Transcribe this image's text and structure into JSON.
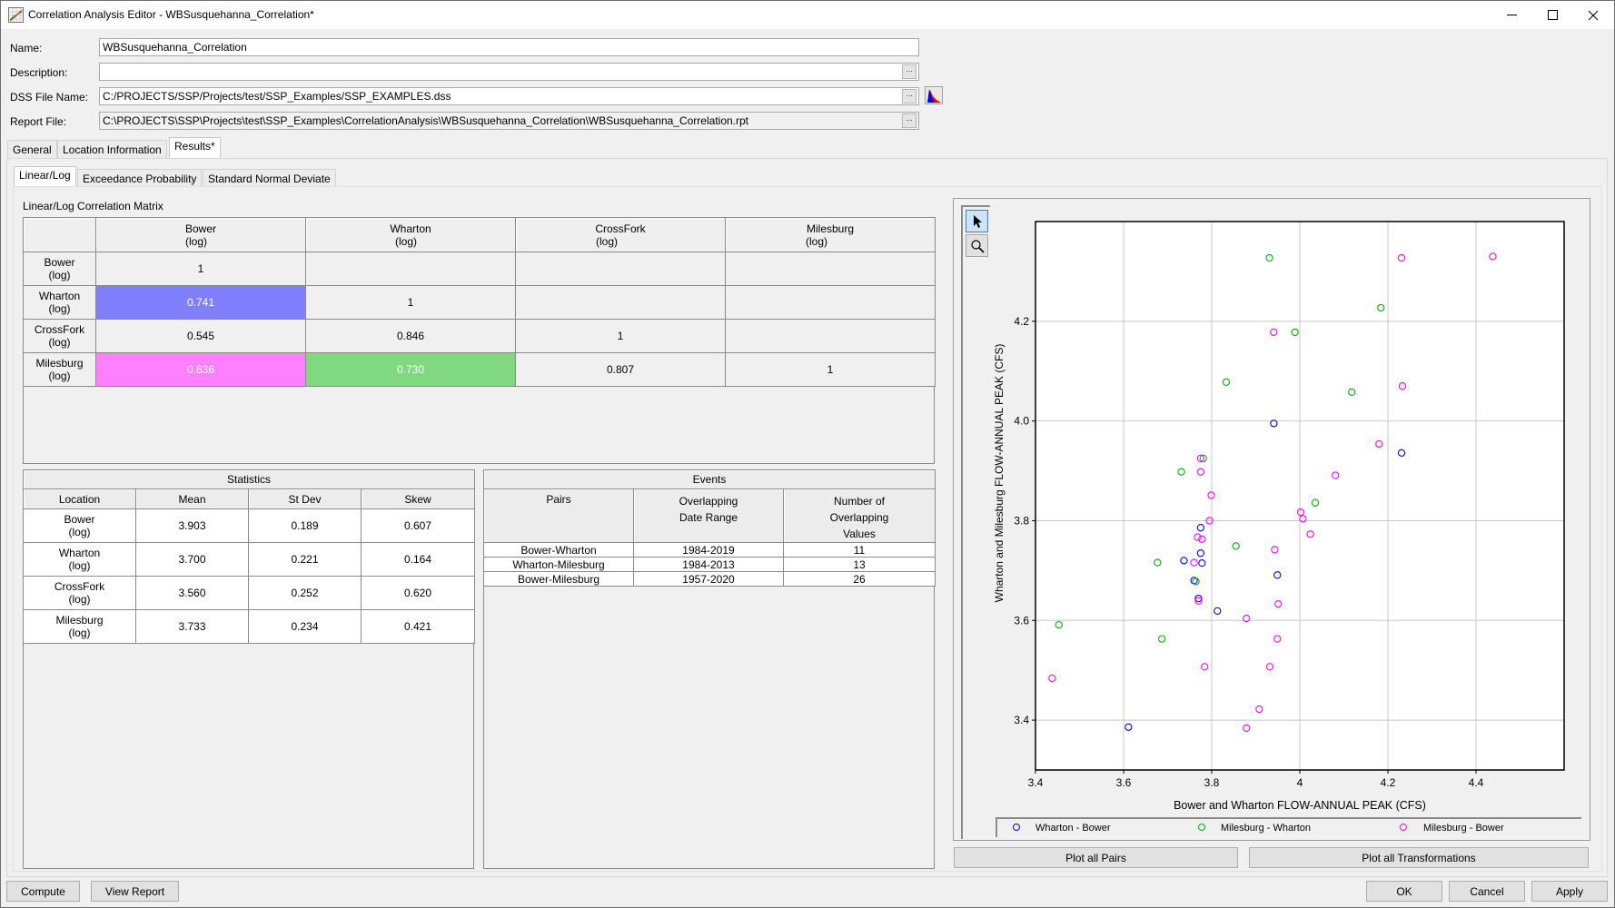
{
  "window": {
    "title": "Correlation Analysis Editor - WBSusquehanna_Correlation*",
    "minimize": "—",
    "maximize": "☐",
    "close": "✕"
  },
  "form": {
    "name_label": "Name:",
    "name_value": "WBSusquehanna_Correlation",
    "description_label": "Description:",
    "description_value": "",
    "dss_label": "DSS File Name:",
    "dss_value": "C:/PROJECTS/SSP/Projects/test/SSP_Examples/SSP_EXAMPLES.dss",
    "report_label": "Report File:",
    "report_value": "C:\\PROJECTS\\SSP\\Projects\\test\\SSP_Examples\\CorrelationAnalysis\\WBSusquehanna_Correlation\\WBSusquehanna_Correlation.rpt",
    "browse_label": "..."
  },
  "tabs": [
    {
      "label": "General",
      "active": false
    },
    {
      "label": "Location Information",
      "active": false
    },
    {
      "label": "Results*",
      "active": true
    }
  ],
  "subtabs": [
    {
      "label": "Linear/Log",
      "active": true
    },
    {
      "label": "Exceedance Probability",
      "active": false
    },
    {
      "label": "Standard Normal Deviate",
      "active": false
    }
  ],
  "matrix": {
    "title": "Linear/Log Correlation Matrix",
    "columns": [
      {
        "name": "Bower",
        "unit": "(log)"
      },
      {
        "name": "Wharton",
        "unit": "(log)"
      },
      {
        "name": "CrossFork",
        "unit": "(log)"
      },
      {
        "name": "Milesburg",
        "unit": "(log)"
      }
    ],
    "rows": [
      {
        "name": "Bower",
        "unit": "(log)",
        "cells": [
          "1",
          "",
          "",
          ""
        ]
      },
      {
        "name": "Wharton",
        "unit": "(log)",
        "cells": [
          "0.741",
          "1",
          "",
          ""
        ]
      },
      {
        "name": "CrossFork",
        "unit": "(log)",
        "cells": [
          "0.545",
          "0.846",
          "1",
          ""
        ]
      },
      {
        "name": "Milesburg",
        "unit": "(log)",
        "cells": [
          "0.636",
          "0.730",
          "0.807",
          "1"
        ]
      }
    ],
    "highlights": {
      "wharton_bower": "#8080ff",
      "milesburg_bower": "#ff80ff",
      "milesburg_wharton": "#80d880"
    }
  },
  "statistics": {
    "title": "Statistics",
    "headers": [
      "Location",
      "Mean",
      "St Dev",
      "Skew"
    ],
    "rows": [
      {
        "name": "Bower",
        "unit": "(log)",
        "mean": "3.903",
        "stdev": "0.189",
        "skew": "0.607"
      },
      {
        "name": "Wharton",
        "unit": "(log)",
        "mean": "3.700",
        "stdev": "0.221",
        "skew": "0.164"
      },
      {
        "name": "CrossFork",
        "unit": "(log)",
        "mean": "3.560",
        "stdev": "0.252",
        "skew": "0.620"
      },
      {
        "name": "Milesburg",
        "unit": "(log)",
        "mean": "3.733",
        "stdev": "0.234",
        "skew": "0.421"
      }
    ]
  },
  "events": {
    "title": "Events",
    "headers": {
      "pairs": "Pairs",
      "range_1": "Overlapping",
      "range_2": "Date Range",
      "count_1": "Number of",
      "count_2": "Overlapping",
      "count_3": "Values"
    },
    "rows": [
      {
        "pair": "Bower-Wharton",
        "range": "1984-2019",
        "count": "11"
      },
      {
        "pair": "Wharton-Milesburg",
        "range": "1984-2013",
        "count": "13"
      },
      {
        "pair": "Bower-Milesburg",
        "range": "1957-2020",
        "count": "26"
      }
    ]
  },
  "chart_tools": {
    "pointer": "pointer-tool",
    "zoom": "zoom-tool"
  },
  "chart_data": {
    "type": "scatter",
    "title": "",
    "xlabel": "Bower and Wharton FLOW-ANNUAL PEAK (CFS)",
    "ylabel": "Wharton and Milesburg FLOW-ANNUAL PEAK (CFS)",
    "xlim": [
      3.4,
      4.6
    ],
    "ylim": [
      3.3,
      4.4
    ],
    "xticks": [
      "3.4",
      "3.6",
      "3.8",
      "4",
      "4.2",
      "4.4"
    ],
    "xtick_values": [
      3.4,
      3.6,
      3.8,
      4.0,
      4.2,
      4.4
    ],
    "yticks": [
      "3.4",
      "3.6",
      "3.8",
      "4.0",
      "4.2"
    ],
    "ytick_values": [
      3.4,
      3.6,
      3.8,
      4.0,
      4.2
    ],
    "grid": true,
    "legend_position": "bottom",
    "series": [
      {
        "name": "Wharton - Bower",
        "color": "#0000ff",
        "points": [
          [
            3.941,
            3.995
          ],
          [
            4.231,
            3.936
          ],
          [
            3.775,
            3.786
          ],
          [
            3.737,
            3.72
          ],
          [
            3.775,
            3.735
          ],
          [
            3.778,
            3.715
          ],
          [
            3.76,
            3.68
          ],
          [
            3.77,
            3.644
          ],
          [
            3.813,
            3.619
          ],
          [
            3.949,
            3.691
          ],
          [
            3.611,
            3.386
          ]
        ]
      },
      {
        "name": "Milesburg - Wharton",
        "color": "#00b000",
        "points": [
          [
            3.931,
            4.327
          ],
          [
            4.184,
            4.227
          ],
          [
            3.989,
            4.178
          ],
          [
            3.833,
            4.078
          ],
          [
            4.118,
            4.058
          ],
          [
            3.781,
            3.925
          ],
          [
            3.731,
            3.898
          ],
          [
            4.035,
            3.836
          ],
          [
            3.855,
            3.749
          ],
          [
            3.677,
            3.716
          ],
          [
            3.764,
            3.678
          ],
          [
            3.453,
            3.591
          ],
          [
            3.687,
            3.563
          ]
        ]
      },
      {
        "name": "Milesburg - Bower",
        "color": "#ff00ff",
        "points": [
          [
            4.438,
            4.33
          ],
          [
            4.231,
            4.327
          ],
          [
            3.941,
            4.178
          ],
          [
            4.233,
            4.07
          ],
          [
            4.18,
            3.954
          ],
          [
            3.775,
            3.925
          ],
          [
            3.775,
            3.898
          ],
          [
            4.081,
            3.891
          ],
          [
            3.799,
            3.851
          ],
          [
            4.002,
            3.817
          ],
          [
            4.007,
            3.804
          ],
          [
            3.795,
            3.8
          ],
          [
            4.024,
            3.773
          ],
          [
            3.768,
            3.767
          ],
          [
            3.778,
            3.763
          ],
          [
            3.943,
            3.742
          ],
          [
            3.76,
            3.716
          ],
          [
            3.77,
            3.639
          ],
          [
            3.951,
            3.633
          ],
          [
            3.879,
            3.604
          ],
          [
            3.949,
            3.563
          ],
          [
            3.784,
            3.507
          ],
          [
            3.932,
            3.507
          ],
          [
            3.438,
            3.484
          ],
          [
            3.908,
            3.422
          ],
          [
            3.879,
            3.384
          ]
        ]
      }
    ]
  },
  "buttons": {
    "plot_all_pairs": "Plot all Pairs",
    "plot_all_transformations": "Plot all Transformations",
    "compute": "Compute",
    "view_report": "View Report",
    "ok": "OK",
    "cancel": "Cancel",
    "apply": "Apply"
  }
}
